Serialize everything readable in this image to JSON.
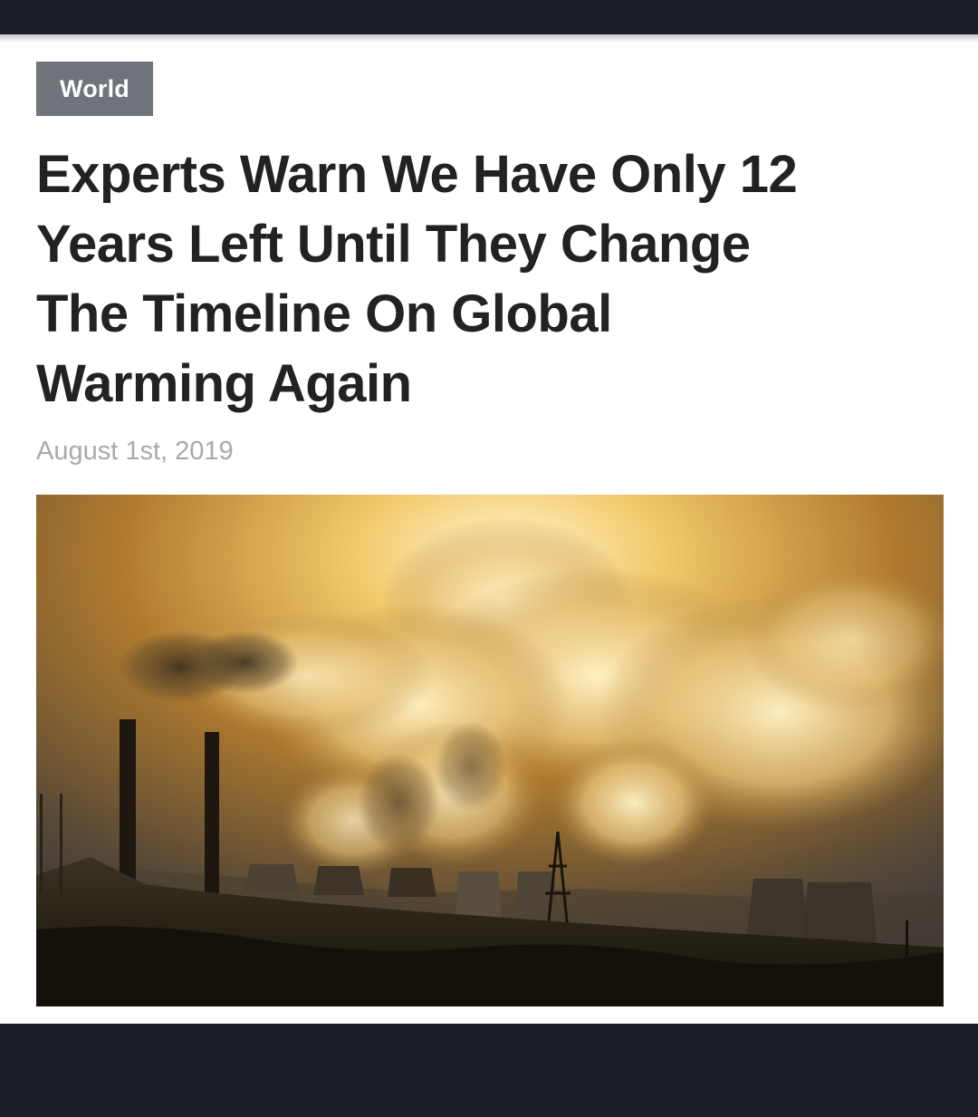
{
  "article": {
    "category": "World",
    "headline_lines": [
      "Experts Warn We Have Only 12",
      "Years Left Until They Change",
      "The Timeline On Global",
      "Warming Again"
    ],
    "date": "August 1st, 2019"
  },
  "colors": {
    "page_background": "#ffffff",
    "chrome_bar": "#1c1f26",
    "badge_background": "#6f737a",
    "headline_text": "#222222",
    "date_text": "#a9a9a9"
  },
  "icons": []
}
